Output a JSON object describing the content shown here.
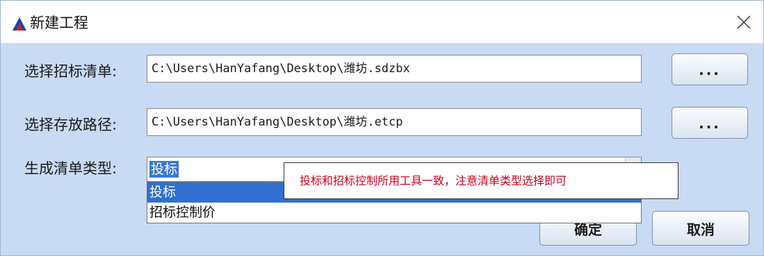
{
  "dialog": {
    "title": "新建工程",
    "close_icon": "close-icon",
    "app_icon": "triangle-logo-icon"
  },
  "form": {
    "bid_list_label": "选择招标清单:",
    "bid_list_path": "C:\\Users\\HanYafang\\Desktop\\潍坊.sdzbx",
    "save_path_label": "选择存放路径:",
    "save_path": "C:\\Users\\HanYafang\\Desktop\\潍坊.etcp",
    "browse_label": "...",
    "list_type_label": "生成清单类型:",
    "list_type_selected": "投标",
    "list_type_options": [
      "投标",
      "招标控制价"
    ]
  },
  "annotation": {
    "text": "投标和招标控制所用工具一致，注意清单类型选择即可"
  },
  "buttons": {
    "ok": "确定",
    "cancel": "取消"
  },
  "colors": {
    "dialog_bg": "#c9daf4",
    "selection": "#2f6fd0",
    "annotation_text": "#d0021b"
  }
}
